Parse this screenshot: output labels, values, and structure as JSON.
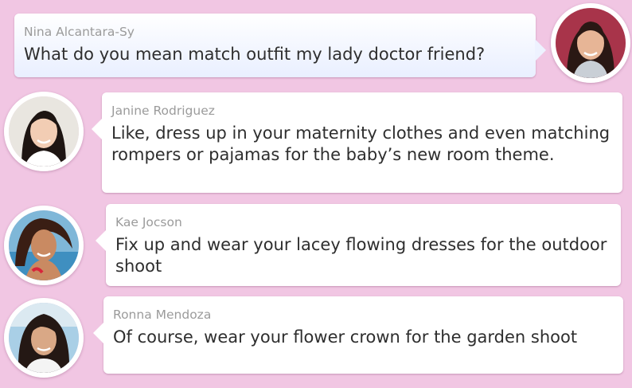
{
  "colors": {
    "background": "#f1c6e3",
    "own_bubble": "#eaf0ff",
    "other_bubble": "#ffffff",
    "sender_name": "#9b9b9b",
    "message_text": "#2e2e2e"
  },
  "messages": [
    {
      "sender": "Nina Alcantara-Sy",
      "text": "What do you mean match outfit my lady doctor friend?",
      "avatar": "nina-avatar",
      "side": "right"
    },
    {
      "sender": "Janine Rodriguez",
      "text": "Like, dress up in your maternity clothes and even matching rompers or pajamas for the baby’s new room theme.",
      "avatar": "janine-avatar",
      "side": "left"
    },
    {
      "sender": "Kae Jocson",
      "text": "Fix up and wear your lacey flowing dresses for the outdoor shoot",
      "avatar": "kae-avatar",
      "side": "left"
    },
    {
      "sender": "Ronna Mendoza",
      "text": "Of course, wear your flower crown for the garden shoot",
      "avatar": "ronna-avatar",
      "side": "left"
    }
  ]
}
